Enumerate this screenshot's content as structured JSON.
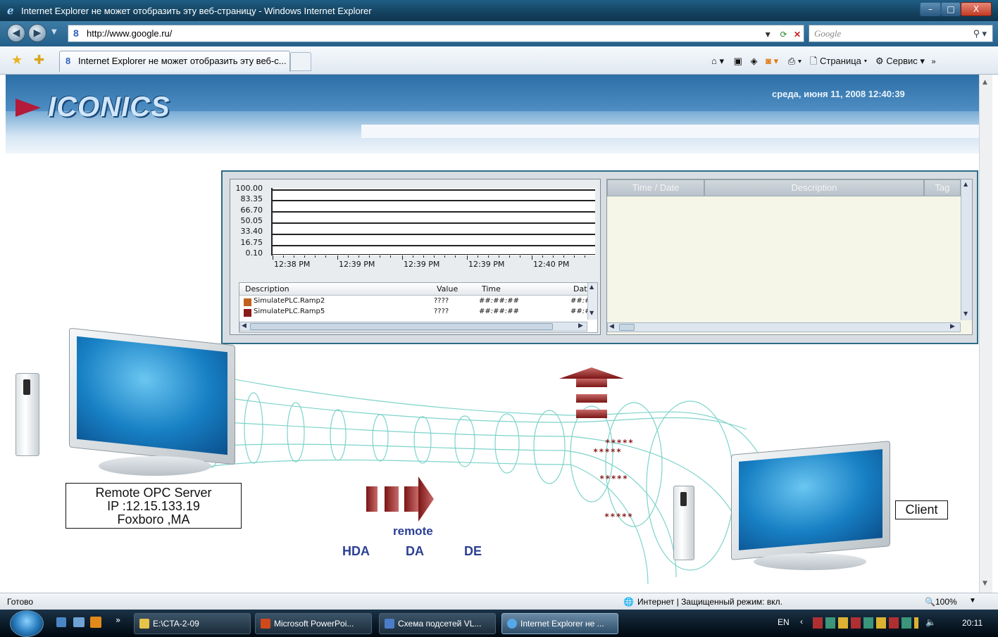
{
  "window": {
    "title": "Internet Explorer не может отобразить эту веб-страницу - Windows Internet Explorer",
    "min_label": "–",
    "max_label": "□",
    "close_label": "X"
  },
  "address_bar": {
    "url": "http://www.google.ru/",
    "search_placeholder": "Google"
  },
  "tab": {
    "label": "Internet Explorer не может отобразить эту веб-с..."
  },
  "command_bar": {
    "page_label": "Страница",
    "service_label": "Сервис"
  },
  "banner": {
    "logo": "ICONICS",
    "datetime": "среда, июня 11, 2008 12:40:39"
  },
  "trend": {
    "y_ticks": [
      "100.00",
      "83.35",
      "66.70",
      "50.05",
      "33.40",
      "16.75",
      "0.10"
    ],
    "x_ticks": [
      "12:38  PM",
      "12:39  PM",
      "12:39  PM",
      "12:39  PM",
      "12:40  PM"
    ],
    "columns": [
      "Description",
      "Value",
      "Time",
      "Date"
    ],
    "rows": [
      {
        "description": "SimulatePLC.Ramp2",
        "value": "????",
        "time": "##:##:##",
        "date": "##:##",
        "color": "#c0621c"
      },
      {
        "description": "SimulatePLC.Ramp5",
        "value": "????",
        "time": "##:##:##",
        "date": "##:##",
        "color": "#8b1a1a"
      }
    ]
  },
  "alarms": {
    "columns": [
      "Time / Date",
      "Description",
      "Tag"
    ]
  },
  "diagram": {
    "server_lines": [
      "Remote OPC Server",
      "IP :12.15.133.19",
      "Foxboro ,MA"
    ],
    "client_label": "Client",
    "remote_label": "remote",
    "protocols": [
      "HDA",
      "DA",
      "DE"
    ],
    "stars": [
      "*****",
      "*****",
      "*****",
      "*****"
    ]
  },
  "status_bar": {
    "status": "Готово",
    "zone": "Интернет | Защищенный режим: вкл.",
    "zoom": "100%"
  },
  "taskbar": {
    "buttons": [
      "E:\\CTA-2-09",
      "Microsoft PowerPoi...",
      "Схема подсетей VL...",
      "Internet Explorer не ..."
    ],
    "language": "EN",
    "clock": "20:11"
  }
}
